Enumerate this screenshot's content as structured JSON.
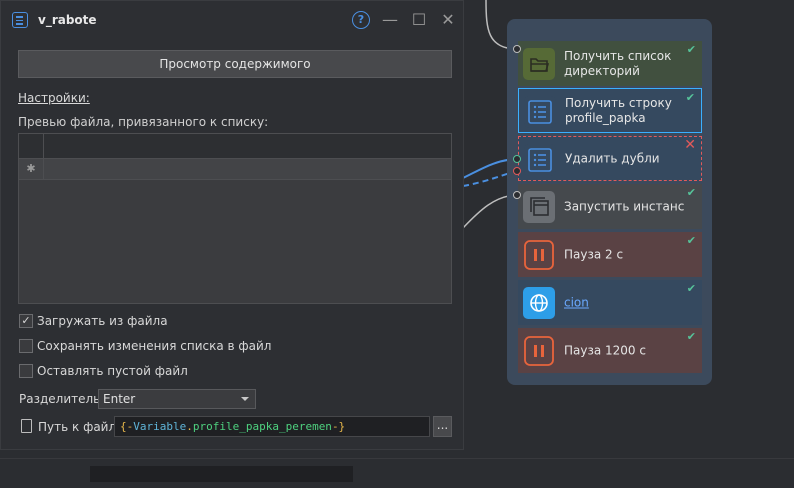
{
  "dialog": {
    "title": "v_rabote",
    "help_label": "?",
    "minimize_label": "—",
    "maximize_label": "☐",
    "close_label": "✕",
    "preview_button": "Просмотр содержимого",
    "settings_label": "Настройки:",
    "preview_label": "Превью файла, привязанного к списку:",
    "grid_new_row_marker": "✱",
    "options": [
      {
        "label": "Загружать из файла",
        "checked": true,
        "check_mark": "✓"
      },
      {
        "label": "Сохранять изменения списка в файл",
        "checked": false,
        "check_mark": ""
      },
      {
        "label": "Оставлять пустой файл",
        "checked": false,
        "check_mark": ""
      }
    ],
    "separator_label": "Разделитель:",
    "separator_value": "Enter",
    "file_path_label": "Путь к файлу",
    "file_path": {
      "open": "{-",
      "scope": "Variable",
      "dot": ".",
      "name": "profile_papka_peremen",
      "close": "-}"
    },
    "browse_button": "..."
  },
  "nodes": [
    {
      "title": "Получить список директорий",
      "line1": "Получить список",
      "line2": "директорий",
      "icon": "folder-icon",
      "status": "ok",
      "status_mark": "✔",
      "bg": "#41503f",
      "icon_bg": "#566a36"
    },
    {
      "title": "Получить строку profile_papka",
      "line1": "Получить строку",
      "line2": "profile_papka",
      "icon": "list-icon",
      "status": "ok",
      "status_mark": "✔",
      "bg": "#35495f",
      "icon_bg": "#35495f",
      "selected": true
    },
    {
      "title": "Удалить дубли",
      "line1": "Удалить дубли",
      "line2": "",
      "icon": "list-icon",
      "status": "error",
      "status_mark": "✕",
      "bg": "#35495f",
      "icon_bg": "#35495f"
    },
    {
      "title": "Запустить инстанс",
      "line1": "Запустить инстанс",
      "line2": "",
      "icon": "window-stack-icon",
      "status": "ok",
      "status_mark": "✔",
      "bg": "#45494d",
      "icon_bg": "#6b6f74"
    },
    {
      "title": "Пауза 2 с",
      "line1": "Пауза 2 с",
      "line2": "",
      "icon": "pause-icon",
      "status": "ok",
      "status_mark": "✔",
      "bg": "#5a4244",
      "icon_bg": "#5a4244"
    },
    {
      "title": "cion",
      "line1": "cion",
      "line2": "",
      "icon": "globe-icon",
      "status": "ok",
      "status_mark": "✔",
      "bg": "#35495f",
      "icon_bg": "#2d9ee8"
    },
    {
      "title": "Пауза 1200 с",
      "line1": "Пауза 1200 с",
      "line2": "",
      "icon": "pause-icon",
      "status": "ok",
      "status_mark": "✔",
      "bg": "#5a4244",
      "icon_bg": "#5a4244"
    }
  ],
  "colors": {
    "accent": "#4a8fe0",
    "ok": "#56c39a",
    "error": "#e25a5a",
    "group_bg": "#3c4a5c"
  }
}
